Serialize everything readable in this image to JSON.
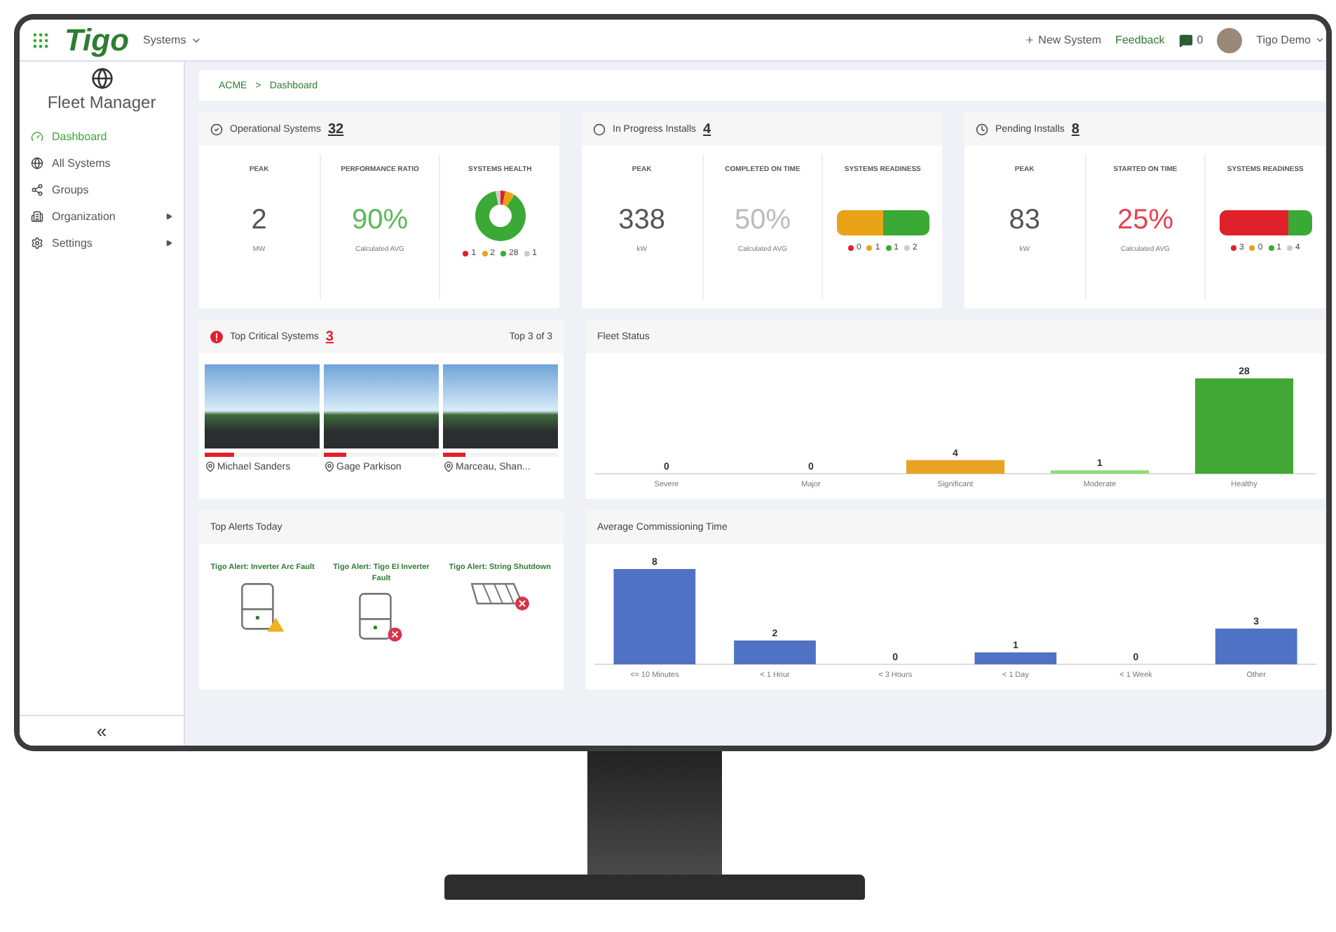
{
  "topbar": {
    "logo": "Tigo",
    "menu": "Systems",
    "new_system": "New System",
    "feedback": "Feedback",
    "messages": "0",
    "user": "Tigo Demo"
  },
  "sidebar": {
    "title": "Fleet Manager",
    "items": [
      {
        "label": "Dashboard",
        "selected": true,
        "submenu": false
      },
      {
        "label": "All Systems",
        "selected": false,
        "submenu": false
      },
      {
        "label": "Groups",
        "selected": false,
        "submenu": false
      },
      {
        "label": "Organization",
        "selected": false,
        "submenu": true
      },
      {
        "label": "Settings",
        "selected": false,
        "submenu": true
      }
    ],
    "collapse": "«"
  },
  "breadcrumb": {
    "items": [
      "ACME",
      "Dashboard"
    ],
    "separator": ">"
  },
  "summary_cards": [
    {
      "title": "Operational Systems",
      "count": "32",
      "metrics": [
        {
          "kind": "number",
          "label": "PEAK",
          "value": "2",
          "unit": "MW"
        },
        {
          "kind": "percent",
          "label": "PERFORMANCE RATIO",
          "value": "90%",
          "unit": "Calculated AVG",
          "color": "#5cb85c"
        },
        {
          "kind": "donut",
          "label": "SYSTEMS HEALTH",
          "chart_data": {
            "type": "donut",
            "values": [
              3.125,
              6.25,
              87.5,
              3.125
            ]
          },
          "legend": [
            {
              "value": "1",
              "color": "#e0202a"
            },
            {
              "value": "2",
              "color": "#e8a317"
            },
            {
              "value": "28",
              "color": "#3aa935"
            },
            {
              "value": "1",
              "color": "#cccccc"
            }
          ]
        }
      ]
    },
    {
      "title": "In Progress Installs",
      "count": "4",
      "metrics": [
        {
          "kind": "number",
          "label": "PEAK",
          "value": "338",
          "unit": "kW"
        },
        {
          "kind": "percent",
          "label": "COMPLETED ON TIME",
          "value": "50%",
          "unit": "Calculated AVG",
          "color": "#bbbbbb"
        },
        {
          "kind": "stacked_bar",
          "label": "SYSTEMS READINESS",
          "fill": {
            "level": 0.5,
            "color": "#e8a317"
          },
          "legend": [
            {
              "value": "0",
              "color": "#e0202a"
            },
            {
              "value": "1",
              "color": "#e8a317"
            },
            {
              "value": "1",
              "color": "#3aa935"
            },
            {
              "value": "2",
              "color": "#cccccc"
            }
          ]
        }
      ]
    },
    {
      "title": "Pending Installs",
      "count": "8",
      "metrics": [
        {
          "kind": "number",
          "label": "PEAK",
          "value": "83",
          "unit": "kW"
        },
        {
          "kind": "percent",
          "label": "STARTED ON TIME",
          "value": "25%",
          "unit": "Calculated AVG",
          "color": "#e8404f"
        },
        {
          "kind": "stacked_bar",
          "label": "SYSTEMS READINESS",
          "fill": {
            "level": 0.75,
            "color": "#e0202a"
          },
          "legend": [
            {
              "value": "3",
              "color": "#e0202a"
            },
            {
              "value": "0",
              "color": "#e8a317"
            },
            {
              "value": "1",
              "color": "#3aa935"
            },
            {
              "value": "4",
              "color": "#cccccc"
            }
          ]
        }
      ]
    }
  ],
  "critical": {
    "title": "Top Critical Systems",
    "count": "3",
    "range": "Top 3 of 3",
    "systems": [
      {
        "name": "Michael Sanders",
        "level": 0.25
      },
      {
        "name": "Gage Parkison",
        "level": 0.2
      },
      {
        "name": "Marceau, Shan...",
        "level": 0.2
      }
    ]
  },
  "fleet_status": {
    "title": "Fleet Status",
    "bars": [
      {
        "color": "#e8a323"
      },
      {
        "color": "#8fdc7a"
      },
      {
        "color": "#41a835"
      }
    ],
    "chart_data": {
      "type": "bar",
      "categories": [
        "Severe",
        "Major",
        "Significant",
        "Moderate",
        "Healthy"
      ],
      "values": [
        0,
        0,
        4,
        1,
        28
      ],
      "data_labels": true
    }
  },
  "alerts": {
    "title": "Top Alerts Today",
    "items": [
      {
        "title": "Tigo Alert: Inverter Arc Fault",
        "kind": "inverter_warning"
      },
      {
        "title": "Tigo Alert: Tigo EI Inverter Fault",
        "kind": "inverter_error"
      },
      {
        "title": "Tigo Alert: String Shutdown",
        "kind": "panels_error"
      }
    ]
  },
  "commissioning": {
    "title": "Average Commissioning Time",
    "chart_data": {
      "type": "bar",
      "categories": [
        "<= 10 Minutes",
        "< 1 Hour",
        "< 3 Hours",
        "< 1 Day",
        "< 1 Week",
        "Other"
      ],
      "values": [
        8,
        2,
        0,
        1,
        0,
        3
      ],
      "data_labels": true
    }
  }
}
